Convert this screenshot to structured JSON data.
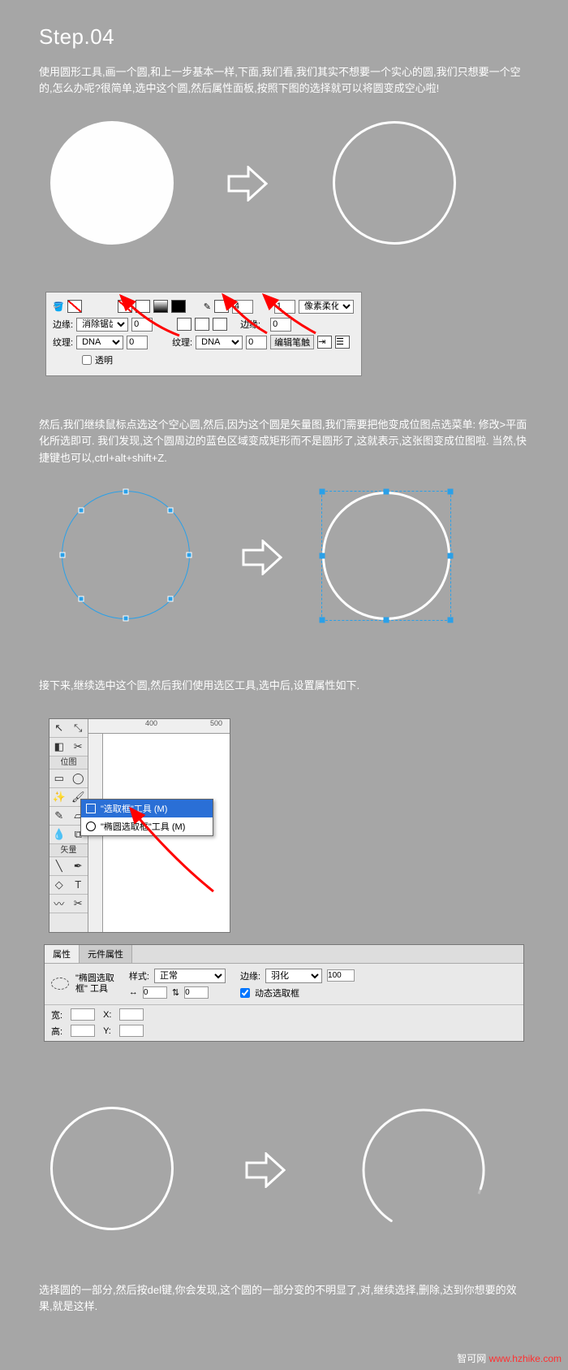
{
  "step_title": "Step.04",
  "para1": "使用圆形工具,画一个圆,和上一步基本一样,下面,我们看,我们其实不想要一个实心的圆,我们只想要一个空的,怎么办呢?很简单,选中这个圆,然后属性面板,按照下图的选择就可以将圆变成空心啦!",
  "panel1": {
    "row1": {
      "stroke_width": "4",
      "edge_value": "1",
      "edge_mode": "像素柔化"
    },
    "row2": {
      "edge_label": "边缘:",
      "edge_select": "消除锯齿",
      "edge_num": "0",
      "side_label": "边缘:",
      "side_num": "0"
    },
    "row3": {
      "texture_label": "纹理:",
      "texture_select": "DNA",
      "texture_num": "0",
      "texture_label2": "纹理:",
      "texture_select2": "DNA",
      "texture_num2": "0",
      "edit_btn": "编辑笔触"
    },
    "transparent_label": "透明"
  },
  "para2": "然后,我们继续鼠标点选这个空心圆,然后,因为这个圆是矢量图,我们需要把他变成位图点选菜单:    修改>平面化所选即可.  我们发现,这个圆周边的蓝色区域变成矩形而不是圆形了,这就表示,这张图变成位图啦.  当然,快捷键也可以,ctrl+alt+shift+Z.",
  "para3": "接下来,继续选中这个圆,然后我们使用选区工具,选中后,设置属性如下.",
  "tools": {
    "label_bitmap": "位图",
    "label_vector": "矢量",
    "ruler_marks": [
      "400",
      "500"
    ],
    "flyout_sel": "\"选取框\"工具 (M)",
    "flyout_item": "\"椭圆选取框\"工具 (M)"
  },
  "panel2": {
    "tab1": "属性",
    "tab2": "元件属性",
    "tool_name_l1": "\"椭圆选取",
    "tool_name_l2": "框\" 工具",
    "style_label": "样式:",
    "style_value": "正常",
    "arrow_h": "↔",
    "val0a": "0",
    "lock": "⇅",
    "val0b": "0",
    "edge_label": "边缘:",
    "edge_value": "羽化",
    "edge_num": "100",
    "dyn_label": "动态选取框",
    "w_label": "宽:",
    "h_label": "高:",
    "x_label": "X:",
    "y_label": "Y:"
  },
  "para4": "选择圆的一部分,然后按del键,你会发现,这个圆的一部分变的不明显了,对,继续选择,删除,达到你想要的效果,就是这样.",
  "watermark_site": "智可网",
  "watermark_domain": "www.hzhike.com"
}
